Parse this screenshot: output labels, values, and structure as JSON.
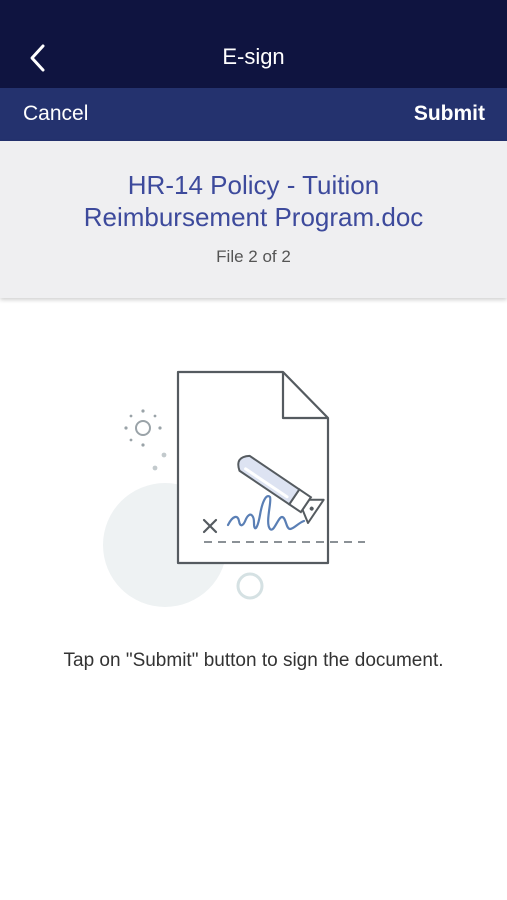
{
  "nav": {
    "title": "E-sign",
    "back_icon": "chevron-left-icon"
  },
  "actions": {
    "cancel_label": "Cancel",
    "submit_label": "Submit"
  },
  "file": {
    "name": "HR-14 Policy - Tuition Reimbursement Program.doc",
    "count": "File 2 of 2"
  },
  "illustration": {
    "icon": "document-signature-icon"
  },
  "instruction": "Tap on \"Submit\" button to sign the document.",
  "colors": {
    "nav_bg": "#0f1440",
    "action_bar_bg": "#24326e",
    "header_bg": "#efeff1",
    "file_name": "#3d4a9c"
  }
}
